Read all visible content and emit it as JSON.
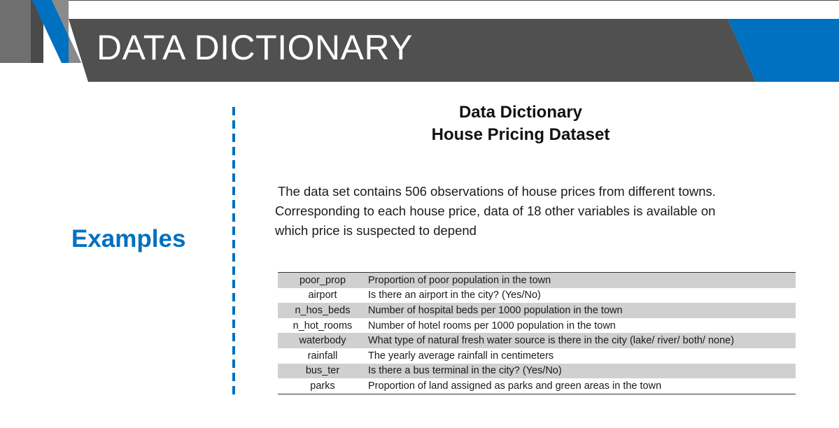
{
  "slide": {
    "title": "DATA DICTIONARY",
    "section_label": "Examples"
  },
  "document": {
    "title_line1": "Data Dictionary",
    "title_line2": "House Pricing Dataset",
    "description_line1": "The data set contains 506 observations of house prices from different towns.",
    "description_line2": "Corresponding to each house price, data of 18 other variables is available on",
    "description_line3": "which price is suspected to depend"
  },
  "table": {
    "rows": [
      {
        "variable": "poor_prop",
        "description": "Proportion of poor population in the town"
      },
      {
        "variable": "airport",
        "description": "Is there an airport in the city? (Yes/No)"
      },
      {
        "variable": "n_hos_beds",
        "description": "Number of hospital beds per 1000 population in the town"
      },
      {
        "variable": "n_hot_rooms",
        "description": "Number of hotel rooms per 1000 population in the town"
      },
      {
        "variable": "waterbody",
        "description": "What type of natural fresh water source is there in the city (lake/ river/ both/ none)"
      },
      {
        "variable": "rainfall",
        "description": "The yearly average rainfall in centimeters"
      },
      {
        "variable": "bus_ter",
        "description": "Is there a bus terminal in the city? (Yes/No)"
      },
      {
        "variable": "parks",
        "description": "Proportion of land assigned as parks and green areas in the town"
      }
    ]
  },
  "colors": {
    "accent_blue": "#0070c0",
    "header_dark": "#505050",
    "header_light": "#7a7a7a",
    "row_shade": "#d0d0d0"
  }
}
